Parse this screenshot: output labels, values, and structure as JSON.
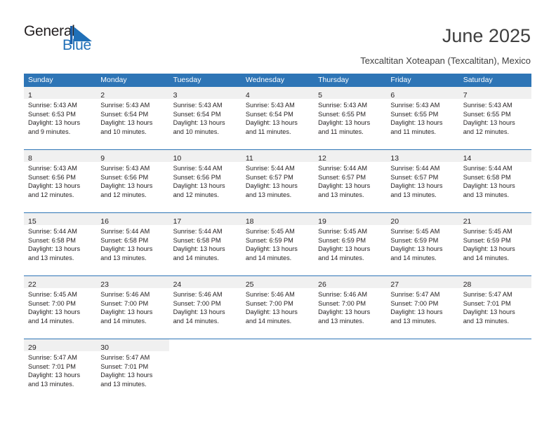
{
  "brand": {
    "name_part1": "General",
    "name_part2": "Blue",
    "accent_color": "#2070b8"
  },
  "header": {
    "title": "June 2025",
    "subtitle": "Texcaltitan Xoteapan (Texcaltitan), Mexico"
  },
  "calendar": {
    "header_color": "#2e75b6",
    "daynum_band_color": "#f0f0f0",
    "weekdays": [
      "Sunday",
      "Monday",
      "Tuesday",
      "Wednesday",
      "Thursday",
      "Friday",
      "Saturday"
    ],
    "weeks": [
      [
        {
          "day": "1",
          "sunrise": "Sunrise: 5:43 AM",
          "sunset": "Sunset: 6:53 PM",
          "daylight_1": "Daylight: 13 hours",
          "daylight_2": "and 9 minutes."
        },
        {
          "day": "2",
          "sunrise": "Sunrise: 5:43 AM",
          "sunset": "Sunset: 6:54 PM",
          "daylight_1": "Daylight: 13 hours",
          "daylight_2": "and 10 minutes."
        },
        {
          "day": "3",
          "sunrise": "Sunrise: 5:43 AM",
          "sunset": "Sunset: 6:54 PM",
          "daylight_1": "Daylight: 13 hours",
          "daylight_2": "and 10 minutes."
        },
        {
          "day": "4",
          "sunrise": "Sunrise: 5:43 AM",
          "sunset": "Sunset: 6:54 PM",
          "daylight_1": "Daylight: 13 hours",
          "daylight_2": "and 11 minutes."
        },
        {
          "day": "5",
          "sunrise": "Sunrise: 5:43 AM",
          "sunset": "Sunset: 6:55 PM",
          "daylight_1": "Daylight: 13 hours",
          "daylight_2": "and 11 minutes."
        },
        {
          "day": "6",
          "sunrise": "Sunrise: 5:43 AM",
          "sunset": "Sunset: 6:55 PM",
          "daylight_1": "Daylight: 13 hours",
          "daylight_2": "and 11 minutes."
        },
        {
          "day": "7",
          "sunrise": "Sunrise: 5:43 AM",
          "sunset": "Sunset: 6:55 PM",
          "daylight_1": "Daylight: 13 hours",
          "daylight_2": "and 12 minutes."
        }
      ],
      [
        {
          "day": "8",
          "sunrise": "Sunrise: 5:43 AM",
          "sunset": "Sunset: 6:56 PM",
          "daylight_1": "Daylight: 13 hours",
          "daylight_2": "and 12 minutes."
        },
        {
          "day": "9",
          "sunrise": "Sunrise: 5:43 AM",
          "sunset": "Sunset: 6:56 PM",
          "daylight_1": "Daylight: 13 hours",
          "daylight_2": "and 12 minutes."
        },
        {
          "day": "10",
          "sunrise": "Sunrise: 5:44 AM",
          "sunset": "Sunset: 6:56 PM",
          "daylight_1": "Daylight: 13 hours",
          "daylight_2": "and 12 minutes."
        },
        {
          "day": "11",
          "sunrise": "Sunrise: 5:44 AM",
          "sunset": "Sunset: 6:57 PM",
          "daylight_1": "Daylight: 13 hours",
          "daylight_2": "and 13 minutes."
        },
        {
          "day": "12",
          "sunrise": "Sunrise: 5:44 AM",
          "sunset": "Sunset: 6:57 PM",
          "daylight_1": "Daylight: 13 hours",
          "daylight_2": "and 13 minutes."
        },
        {
          "day": "13",
          "sunrise": "Sunrise: 5:44 AM",
          "sunset": "Sunset: 6:57 PM",
          "daylight_1": "Daylight: 13 hours",
          "daylight_2": "and 13 minutes."
        },
        {
          "day": "14",
          "sunrise": "Sunrise: 5:44 AM",
          "sunset": "Sunset: 6:58 PM",
          "daylight_1": "Daylight: 13 hours",
          "daylight_2": "and 13 minutes."
        }
      ],
      [
        {
          "day": "15",
          "sunrise": "Sunrise: 5:44 AM",
          "sunset": "Sunset: 6:58 PM",
          "daylight_1": "Daylight: 13 hours",
          "daylight_2": "and 13 minutes."
        },
        {
          "day": "16",
          "sunrise": "Sunrise: 5:44 AM",
          "sunset": "Sunset: 6:58 PM",
          "daylight_1": "Daylight: 13 hours",
          "daylight_2": "and 13 minutes."
        },
        {
          "day": "17",
          "sunrise": "Sunrise: 5:44 AM",
          "sunset": "Sunset: 6:58 PM",
          "daylight_1": "Daylight: 13 hours",
          "daylight_2": "and 14 minutes."
        },
        {
          "day": "18",
          "sunrise": "Sunrise: 5:45 AM",
          "sunset": "Sunset: 6:59 PM",
          "daylight_1": "Daylight: 13 hours",
          "daylight_2": "and 14 minutes."
        },
        {
          "day": "19",
          "sunrise": "Sunrise: 5:45 AM",
          "sunset": "Sunset: 6:59 PM",
          "daylight_1": "Daylight: 13 hours",
          "daylight_2": "and 14 minutes."
        },
        {
          "day": "20",
          "sunrise": "Sunrise: 5:45 AM",
          "sunset": "Sunset: 6:59 PM",
          "daylight_1": "Daylight: 13 hours",
          "daylight_2": "and 14 minutes."
        },
        {
          "day": "21",
          "sunrise": "Sunrise: 5:45 AM",
          "sunset": "Sunset: 6:59 PM",
          "daylight_1": "Daylight: 13 hours",
          "daylight_2": "and 14 minutes."
        }
      ],
      [
        {
          "day": "22",
          "sunrise": "Sunrise: 5:45 AM",
          "sunset": "Sunset: 7:00 PM",
          "daylight_1": "Daylight: 13 hours",
          "daylight_2": "and 14 minutes."
        },
        {
          "day": "23",
          "sunrise": "Sunrise: 5:46 AM",
          "sunset": "Sunset: 7:00 PM",
          "daylight_1": "Daylight: 13 hours",
          "daylight_2": "and 14 minutes."
        },
        {
          "day": "24",
          "sunrise": "Sunrise: 5:46 AM",
          "sunset": "Sunset: 7:00 PM",
          "daylight_1": "Daylight: 13 hours",
          "daylight_2": "and 14 minutes."
        },
        {
          "day": "25",
          "sunrise": "Sunrise: 5:46 AM",
          "sunset": "Sunset: 7:00 PM",
          "daylight_1": "Daylight: 13 hours",
          "daylight_2": "and 14 minutes."
        },
        {
          "day": "26",
          "sunrise": "Sunrise: 5:46 AM",
          "sunset": "Sunset: 7:00 PM",
          "daylight_1": "Daylight: 13 hours",
          "daylight_2": "and 13 minutes."
        },
        {
          "day": "27",
          "sunrise": "Sunrise: 5:47 AM",
          "sunset": "Sunset: 7:00 PM",
          "daylight_1": "Daylight: 13 hours",
          "daylight_2": "and 13 minutes."
        },
        {
          "day": "28",
          "sunrise": "Sunrise: 5:47 AM",
          "sunset": "Sunset: 7:01 PM",
          "daylight_1": "Daylight: 13 hours",
          "daylight_2": "and 13 minutes."
        }
      ],
      [
        {
          "day": "29",
          "sunrise": "Sunrise: 5:47 AM",
          "sunset": "Sunset: 7:01 PM",
          "daylight_1": "Daylight: 13 hours",
          "daylight_2": "and 13 minutes."
        },
        {
          "day": "30",
          "sunrise": "Sunrise: 5:47 AM",
          "sunset": "Sunset: 7:01 PM",
          "daylight_1": "Daylight: 13 hours",
          "daylight_2": "and 13 minutes."
        },
        {
          "day": "",
          "sunrise": "",
          "sunset": "",
          "daylight_1": "",
          "daylight_2": ""
        },
        {
          "day": "",
          "sunrise": "",
          "sunset": "",
          "daylight_1": "",
          "daylight_2": ""
        },
        {
          "day": "",
          "sunrise": "",
          "sunset": "",
          "daylight_1": "",
          "daylight_2": ""
        },
        {
          "day": "",
          "sunrise": "",
          "sunset": "",
          "daylight_1": "",
          "daylight_2": ""
        },
        {
          "day": "",
          "sunrise": "",
          "sunset": "",
          "daylight_1": "",
          "daylight_2": ""
        }
      ]
    ]
  }
}
